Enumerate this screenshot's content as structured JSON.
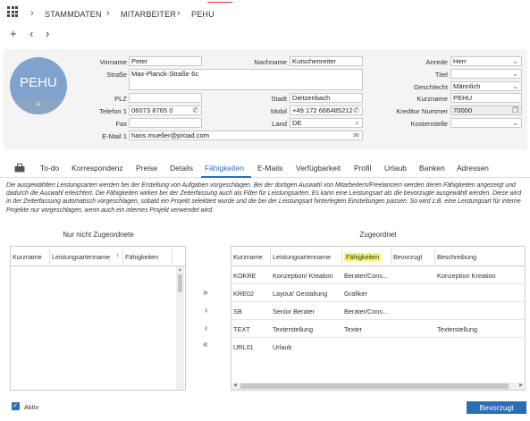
{
  "breadcrumb": [
    "STAMMDATEN",
    "MITARBEITER",
    "PEHU"
  ],
  "avatar": {
    "initials": "PEHU",
    "add": "+"
  },
  "form": {
    "vorname": {
      "label": "Vorname",
      "value": "Peter"
    },
    "nachname": {
      "label": "Nachname",
      "value": "Kutschenreiter"
    },
    "strasse": {
      "label": "Straße",
      "value": "Max-Planck-Straße 6c"
    },
    "plz": {
      "label": "PLZ",
      "value": ""
    },
    "stadt": {
      "label": "Stadt",
      "value": "Dietzenbach"
    },
    "telefon1": {
      "label": "Telefon 1",
      "value": "06073 8765 0"
    },
    "mobil": {
      "label": "Mobil",
      "value": "+49 172 666485212"
    },
    "fax": {
      "label": "Fax",
      "value": ""
    },
    "land": {
      "label": "Land",
      "value": "DE"
    },
    "email1": {
      "label": "E-Mail 1",
      "value": "hans.mueller@proad.com"
    },
    "anrede": {
      "label": "Anrede",
      "value": "Herr"
    },
    "titel": {
      "label": "Titel",
      "value": ""
    },
    "geschlecht": {
      "label": "Geschlecht",
      "value": "Männlich"
    },
    "kurzname": {
      "label": "Kurzname",
      "value": "PEHU"
    },
    "kreditor": {
      "label": "Kreditor Nummer",
      "value": "70000"
    },
    "kostenstelle": {
      "label": "Kostenstelle",
      "value": ""
    }
  },
  "tabs": [
    "To-do",
    "Korrespondenz",
    "Preise",
    "Details",
    "Fähigkeiten",
    "E-Mails",
    "Verfügbarkeit",
    "Profil",
    "Urlaub",
    "Banken",
    "Adressen"
  ],
  "active_tab": "Fähigkeiten",
  "description": "Die ausgewählten Leistungsarten werden bei der Erstellung von Aufgaben vorgeschlagen. Bei der dortigen Auswahl von Mitarbeitern/Freelancern werden deren Fähigkeiten angezeigt und dadurch die Auswahl erleichtert. Die Fähigkeiten wirken bei der Zeiterfassung auch als Filter für Leistungsarten. Es kann eine Leistungsart als die bevorzugte ausgewählt werden. Diese wird in der Zeiterfassung automatisch vorgeschlagen, sobald ein Projekt selektiert wurde und die bei der Leistungsart hinterlegten Einstellungen passen. So wird z.B. eine Leistungsart für interne Projekte nur vorgeschlagen, wenn auch ein internes Projekt verwendet wird.",
  "left_panel": {
    "title": "Nur nicht Zugeordnete",
    "columns": [
      "Kurzname",
      "Leistungsartenname",
      "Fähigkeiten"
    ],
    "sort_indicator": "↑"
  },
  "right_panel": {
    "title": "Zugeordnet",
    "columns": [
      "Kurzname",
      "Leistungsartenname",
      "Fähigkeiten",
      "Bevorzugt",
      "Beschreibung"
    ],
    "highlight_color": "#f5f56a",
    "rows": [
      [
        "KOKRE",
        "Konzeption/ Kreation",
        "Berater/Cons...",
        "",
        "Konzeption Kreation"
      ],
      [
        "KRE02",
        "Layout/ Gestaltung",
        "Grafiker",
        "",
        ""
      ],
      [
        "SB",
        "Senior Berater",
        "Berater/Cons...",
        "",
        ""
      ],
      [
        "TEXT",
        "Texterstellung",
        "Texter",
        "",
        "Texterstellung"
      ],
      [
        "URL01",
        "Urlaub",
        "",
        "",
        ""
      ]
    ]
  },
  "transfer": {
    "all_right": "»",
    "right": "›",
    "left": "‹",
    "all_left": "«"
  },
  "footer": {
    "aktiv_label": "Aktiv",
    "bevorzugt_button": "Bevorzugt"
  },
  "colors": {
    "accent": "#2a6fb4",
    "avatar": "#7fa3cc"
  }
}
